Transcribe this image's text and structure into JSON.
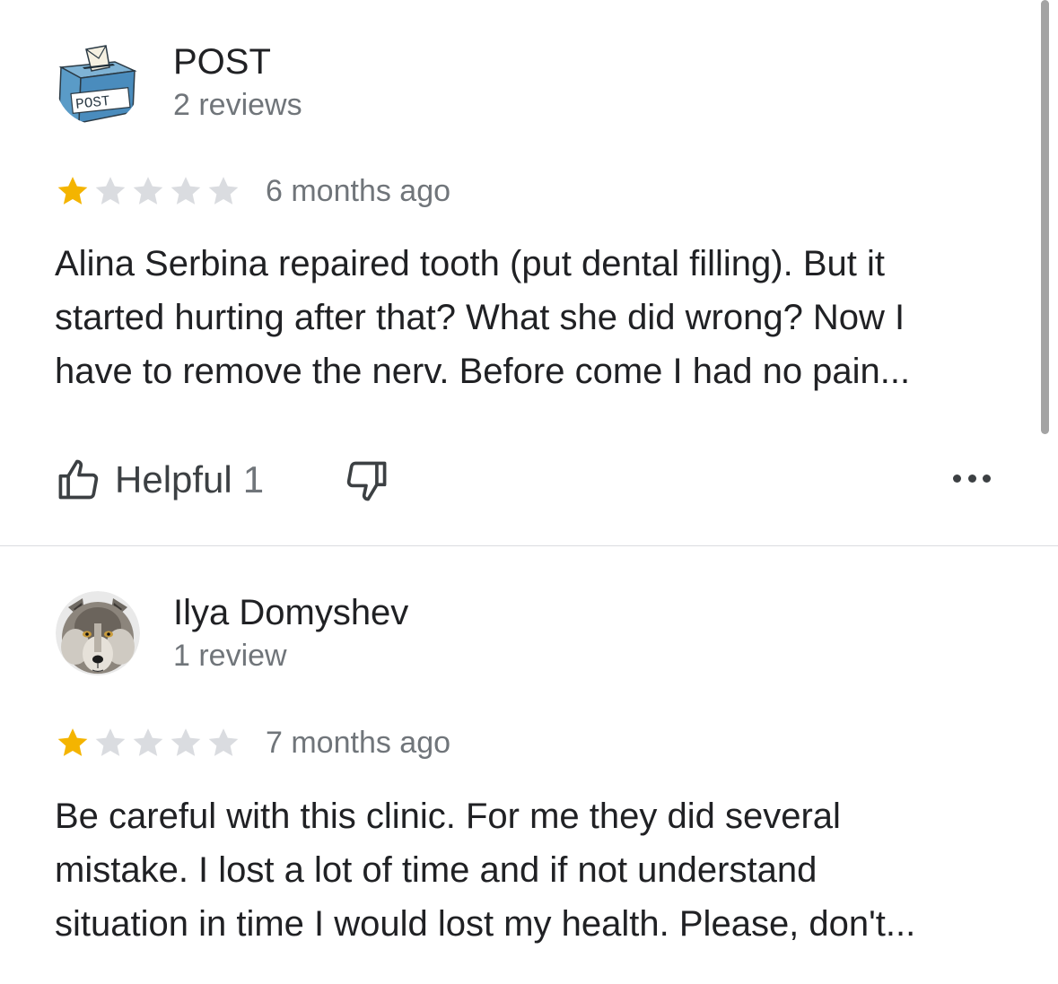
{
  "reviews": [
    {
      "author": {
        "name": "POST",
        "review_count": "2 reviews",
        "avatar": "post-box-avatar",
        "avatar_text": "POST"
      },
      "rating": 1,
      "max_rating": 5,
      "date": "6 months ago",
      "text": "Alina Serbina repaired tooth (put dental filling). But it\nstarted hurting after that? What she did wrong? Now I\nhave to remove the nerv. Before come I had no pain...",
      "actions": {
        "helpful_label": "Helpful",
        "helpful_count": "1",
        "dislike_icon": "thumbs-down-icon",
        "more_icon": "more-horizontal-icon"
      }
    },
    {
      "author": {
        "name": "Ilya Domyshev",
        "review_count": "1 review",
        "avatar": "wolf-photo-avatar"
      },
      "rating": 1,
      "max_rating": 5,
      "date": "7 months ago",
      "text": "Be careful with this clinic. For me they did several\nmistake. I lost a lot of time and if not understand\nsituation in time I would lost my health. Please, don't..."
    }
  ],
  "colors": {
    "star_filled": "#F4B400",
    "star_empty": "#DADCE0",
    "secondary_text": "#70757A",
    "primary_text": "#202124",
    "divider": "#DADCE0"
  }
}
